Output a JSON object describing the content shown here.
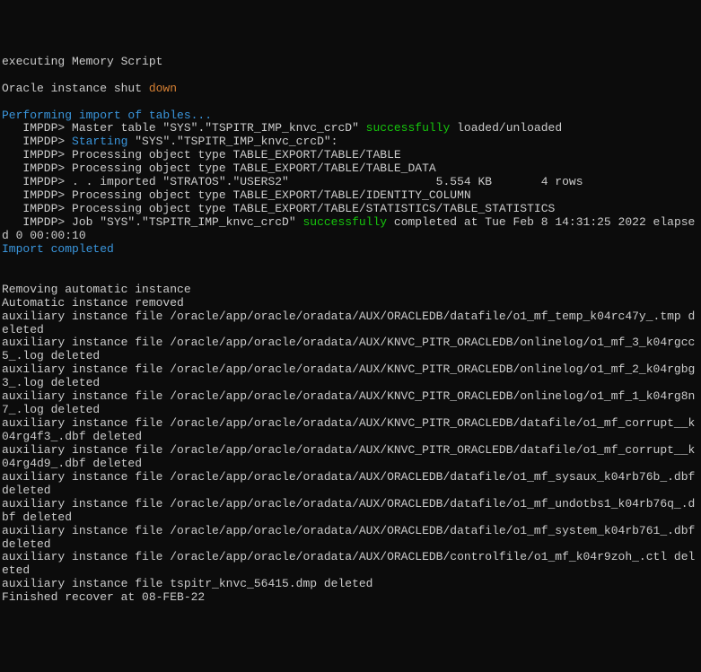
{
  "lines": [
    {
      "segments": [
        {
          "text": "executing Memory Script",
          "class": ""
        }
      ]
    },
    {
      "segments": [
        {
          "text": "",
          "class": ""
        }
      ]
    },
    {
      "segments": [
        {
          "text": "Oracle instance shut ",
          "class": ""
        },
        {
          "text": "down",
          "class": "orange"
        }
      ]
    },
    {
      "segments": [
        {
          "text": "",
          "class": ""
        }
      ]
    },
    {
      "segments": [
        {
          "text": "Performing import of tables...",
          "class": "cyan"
        }
      ]
    },
    {
      "segments": [
        {
          "text": "   IMPDP> Master table \"SYS\".\"TSPITR_IMP_knvc_crcD\" ",
          "class": ""
        },
        {
          "text": "successfully",
          "class": "green"
        },
        {
          "text": " loaded/unloaded",
          "class": ""
        }
      ]
    },
    {
      "segments": [
        {
          "text": "   IMPDP> ",
          "class": ""
        },
        {
          "text": "Starting",
          "class": "cyan"
        },
        {
          "text": " \"SYS\".\"TSPITR_IMP_knvc_crcD\":",
          "class": ""
        }
      ]
    },
    {
      "segments": [
        {
          "text": "   IMPDP> Processing object type TABLE_EXPORT/TABLE/TABLE",
          "class": ""
        }
      ]
    },
    {
      "segments": [
        {
          "text": "   IMPDP> Processing object type TABLE_EXPORT/TABLE/TABLE_DATA",
          "class": ""
        }
      ]
    },
    {
      "segments": [
        {
          "text": "   IMPDP> . . imported \"STRATOS\".\"USERS2\"                     5.554 KB       4 rows",
          "class": ""
        }
      ]
    },
    {
      "segments": [
        {
          "text": "   IMPDP> Processing object type TABLE_EXPORT/TABLE/IDENTITY_COLUMN",
          "class": ""
        }
      ]
    },
    {
      "segments": [
        {
          "text": "   IMPDP> Processing object type TABLE_EXPORT/TABLE/STATISTICS/TABLE_STATISTICS",
          "class": ""
        }
      ]
    },
    {
      "segments": [
        {
          "text": "   IMPDP> Job \"SYS\".\"TSPITR_IMP_knvc_crcD\" ",
          "class": ""
        },
        {
          "text": "successfully",
          "class": "green"
        },
        {
          "text": " completed at Tue Feb 8 14:31:25 2022 elapsed 0 00:00:10",
          "class": ""
        }
      ]
    },
    {
      "segments": [
        {
          "text": "Import completed",
          "class": "cyan"
        }
      ]
    },
    {
      "segments": [
        {
          "text": "",
          "class": ""
        }
      ]
    },
    {
      "segments": [
        {
          "text": "",
          "class": ""
        }
      ]
    },
    {
      "segments": [
        {
          "text": "Removing automatic instance",
          "class": ""
        }
      ]
    },
    {
      "segments": [
        {
          "text": "Automatic instance removed",
          "class": ""
        }
      ]
    },
    {
      "segments": [
        {
          "text": "auxiliary instance file /oracle/app/oracle/oradata/AUX/ORACLEDB/datafile/o1_mf_temp_k04rc47y_.tmp deleted",
          "class": ""
        }
      ]
    },
    {
      "segments": [
        {
          "text": "auxiliary instance file /oracle/app/oracle/oradata/AUX/KNVC_PITR_ORACLEDB/onlinelog/o1_mf_3_k04rgcc5_.log deleted",
          "class": ""
        }
      ]
    },
    {
      "segments": [
        {
          "text": "auxiliary instance file /oracle/app/oracle/oradata/AUX/KNVC_PITR_ORACLEDB/onlinelog/o1_mf_2_k04rgbg3_.log deleted",
          "class": ""
        }
      ]
    },
    {
      "segments": [
        {
          "text": "auxiliary instance file /oracle/app/oracle/oradata/AUX/KNVC_PITR_ORACLEDB/onlinelog/o1_mf_1_k04rg8n7_.log deleted",
          "class": ""
        }
      ]
    },
    {
      "segments": [
        {
          "text": "auxiliary instance file /oracle/app/oracle/oradata/AUX/KNVC_PITR_ORACLEDB/datafile/o1_mf_corrupt__k04rg4f3_.dbf deleted",
          "class": ""
        }
      ]
    },
    {
      "segments": [
        {
          "text": "auxiliary instance file /oracle/app/oracle/oradata/AUX/KNVC_PITR_ORACLEDB/datafile/o1_mf_corrupt__k04rg4d9_.dbf deleted",
          "class": ""
        }
      ]
    },
    {
      "segments": [
        {
          "text": "auxiliary instance file /oracle/app/oracle/oradata/AUX/ORACLEDB/datafile/o1_mf_sysaux_k04rb76b_.dbf deleted",
          "class": ""
        }
      ]
    },
    {
      "segments": [
        {
          "text": "auxiliary instance file /oracle/app/oracle/oradata/AUX/ORACLEDB/datafile/o1_mf_undotbs1_k04rb76q_.dbf deleted",
          "class": ""
        }
      ]
    },
    {
      "segments": [
        {
          "text": "auxiliary instance file /oracle/app/oracle/oradata/AUX/ORACLEDB/datafile/o1_mf_system_k04rb761_.dbf deleted",
          "class": ""
        }
      ]
    },
    {
      "segments": [
        {
          "text": "auxiliary instance file /oracle/app/oracle/oradata/AUX/ORACLEDB/controlfile/o1_mf_k04r9zoh_.ctl deleted",
          "class": ""
        }
      ]
    },
    {
      "segments": [
        {
          "text": "auxiliary instance file tspitr_knvc_56415.dmp deleted",
          "class": ""
        }
      ]
    },
    {
      "segments": [
        {
          "text": "Finished recover at 08-FEB-22",
          "class": ""
        }
      ]
    }
  ]
}
